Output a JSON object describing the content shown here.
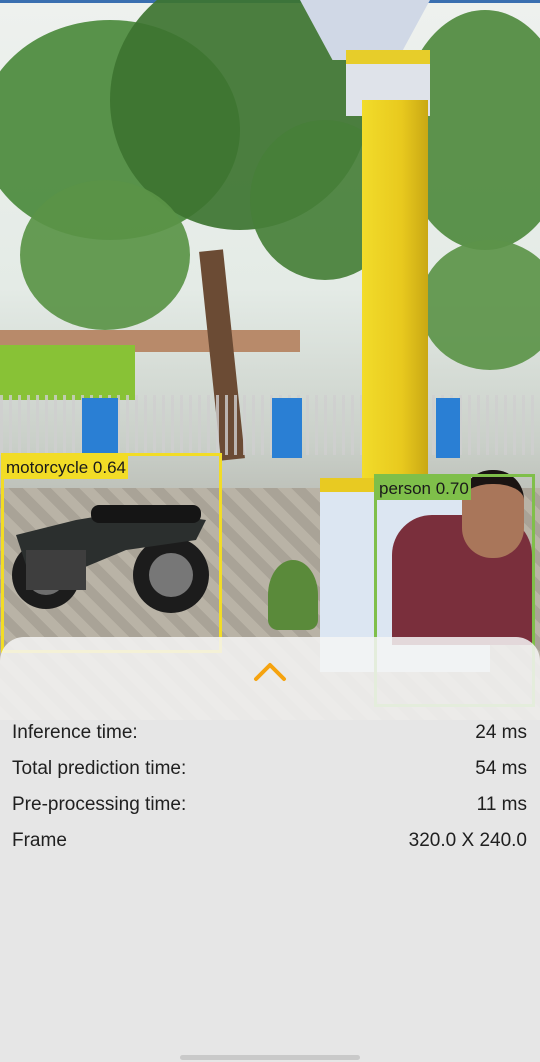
{
  "detections": [
    {
      "label": "motorcycle 0.64",
      "color": "#f2dc26"
    },
    {
      "label": "person 0.70",
      "color": "#7fbf4a"
    }
  ],
  "sheet": {
    "expand_icon": "chevron-up-icon",
    "accent_color": "#f5a30f",
    "rows": [
      {
        "label": "Inference time:",
        "value": "24 ms"
      },
      {
        "label": "Total prediction time:",
        "value": "54 ms"
      },
      {
        "label": "Pre-processing time:",
        "value": "11 ms"
      },
      {
        "label": "Frame",
        "value": "320.0 X 240.0"
      }
    ]
  }
}
